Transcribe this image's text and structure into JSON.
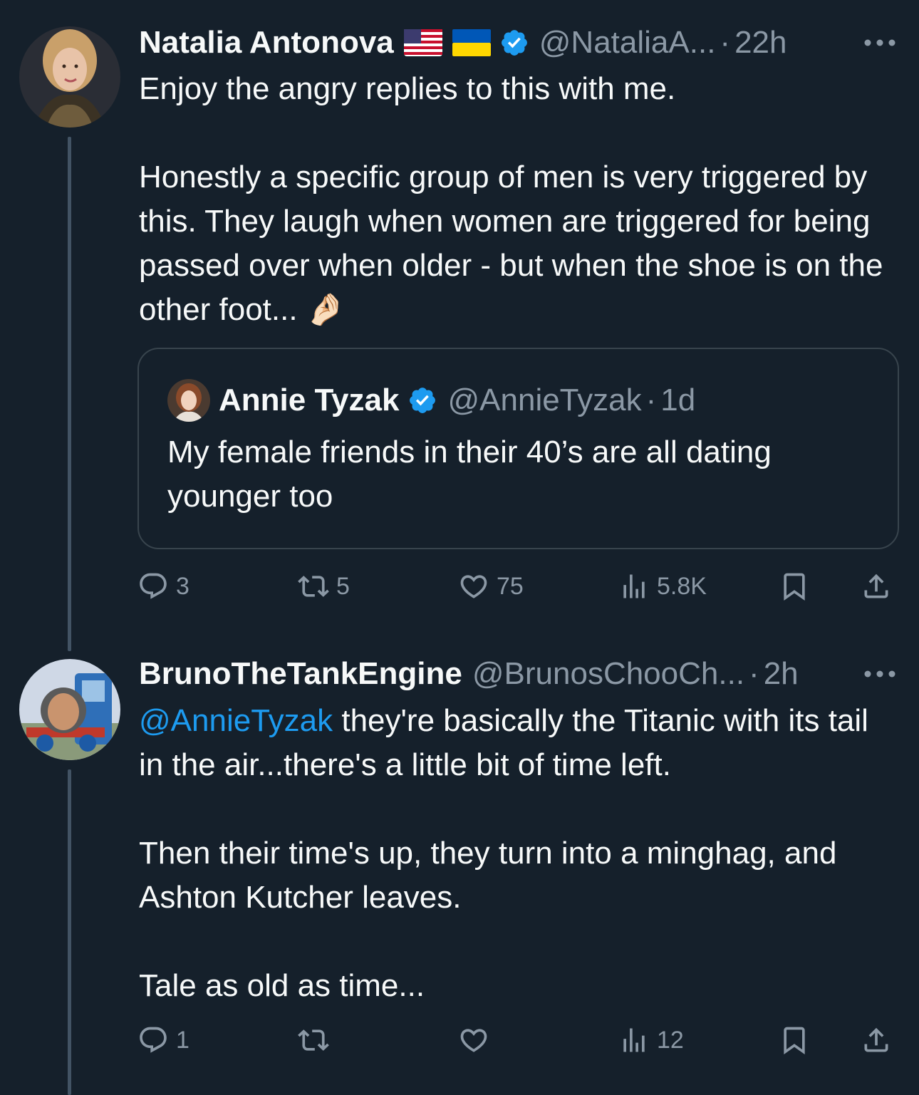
{
  "tweet1": {
    "display_name": "Natalia Antonova",
    "flags": [
      "us-flag-icon",
      "ukraine-flag-icon"
    ],
    "handle": "@NataliaA...",
    "separator": "·",
    "time": "22h",
    "text": "Enjoy the angry replies to this with me.\n\nHonestly a specific group of men is very triggered by this. They laugh when women are triggered for being passed over when older - but when the shoe is on the other foot... 🤌🏻",
    "quote": {
      "display_name": "Annie Tyzak",
      "handle": "@AnnieTyzak",
      "separator": "·",
      "time": "1d",
      "text": "My female friends in their 40’s are all dating younger too"
    },
    "actions": {
      "replies": "3",
      "reposts": "5",
      "likes": "75",
      "views": "5.8K"
    }
  },
  "tweet2": {
    "display_name": "BrunoTheTankEngine",
    "handle": "@BrunosChooCh...",
    "separator": "·",
    "time": "2h",
    "mention": "@AnnieTyzak",
    "text_after_mention": " they're basically the Titanic with its tail in the air...there's a little bit of time left.\n\nThen their time's up, they turn into a minghag, and Ashton Kutcher leaves.\n\nTale as old as time...",
    "actions": {
      "replies": "1",
      "reposts": "",
      "likes": "",
      "views": "12"
    }
  },
  "colors": {
    "background": "#15202b",
    "text": "#f7f9f9",
    "muted": "#8b98a5",
    "accent": "#1d9bf0",
    "border": "#38444d"
  }
}
